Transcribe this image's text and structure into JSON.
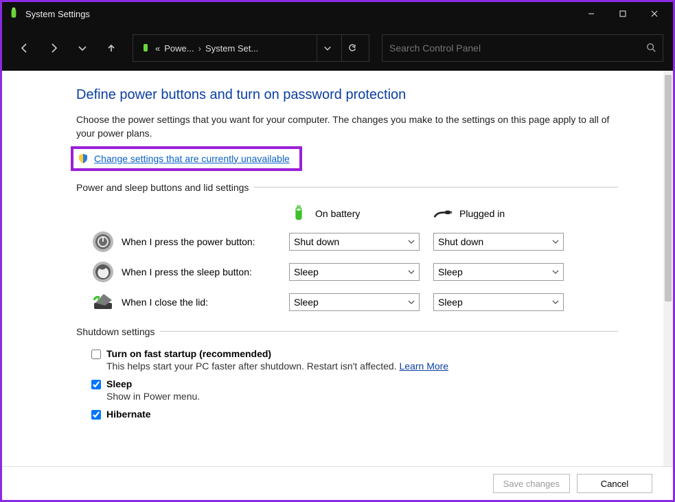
{
  "window": {
    "title": "System Settings"
  },
  "breadcrumb": {
    "abbrev": "«",
    "part1": "Powe...",
    "part2": "System Set..."
  },
  "search": {
    "placeholder": "Search Control Panel"
  },
  "page": {
    "heading": "Define power buttons and turn on password protection",
    "description": "Choose the power settings that you want for your computer. The changes you make to the settings on this page apply to all of your power plans.",
    "change_link": "Change settings that are currently unavailable"
  },
  "power_section": {
    "legend": "Power and sleep buttons and lid settings",
    "col_battery": "On battery",
    "col_plugged": "Plugged in",
    "rows": [
      {
        "label": "When I press the power button:",
        "battery": "Shut down",
        "plugged": "Shut down"
      },
      {
        "label": "When I press the sleep button:",
        "battery": "Sleep",
        "plugged": "Sleep"
      },
      {
        "label": "When I close the lid:",
        "battery": "Sleep",
        "plugged": "Sleep"
      }
    ]
  },
  "shutdown_section": {
    "legend": "Shutdown settings",
    "items": [
      {
        "title": "Turn on fast startup (recommended)",
        "sub": "This helps start your PC faster after shutdown. Restart isn't affected.",
        "link": "Learn More",
        "checked": false
      },
      {
        "title": "Sleep",
        "sub": "Show in Power menu.",
        "checked": true
      },
      {
        "title": "Hibernate",
        "checked": true
      }
    ]
  },
  "footer": {
    "save": "Save changes",
    "cancel": "Cancel"
  }
}
